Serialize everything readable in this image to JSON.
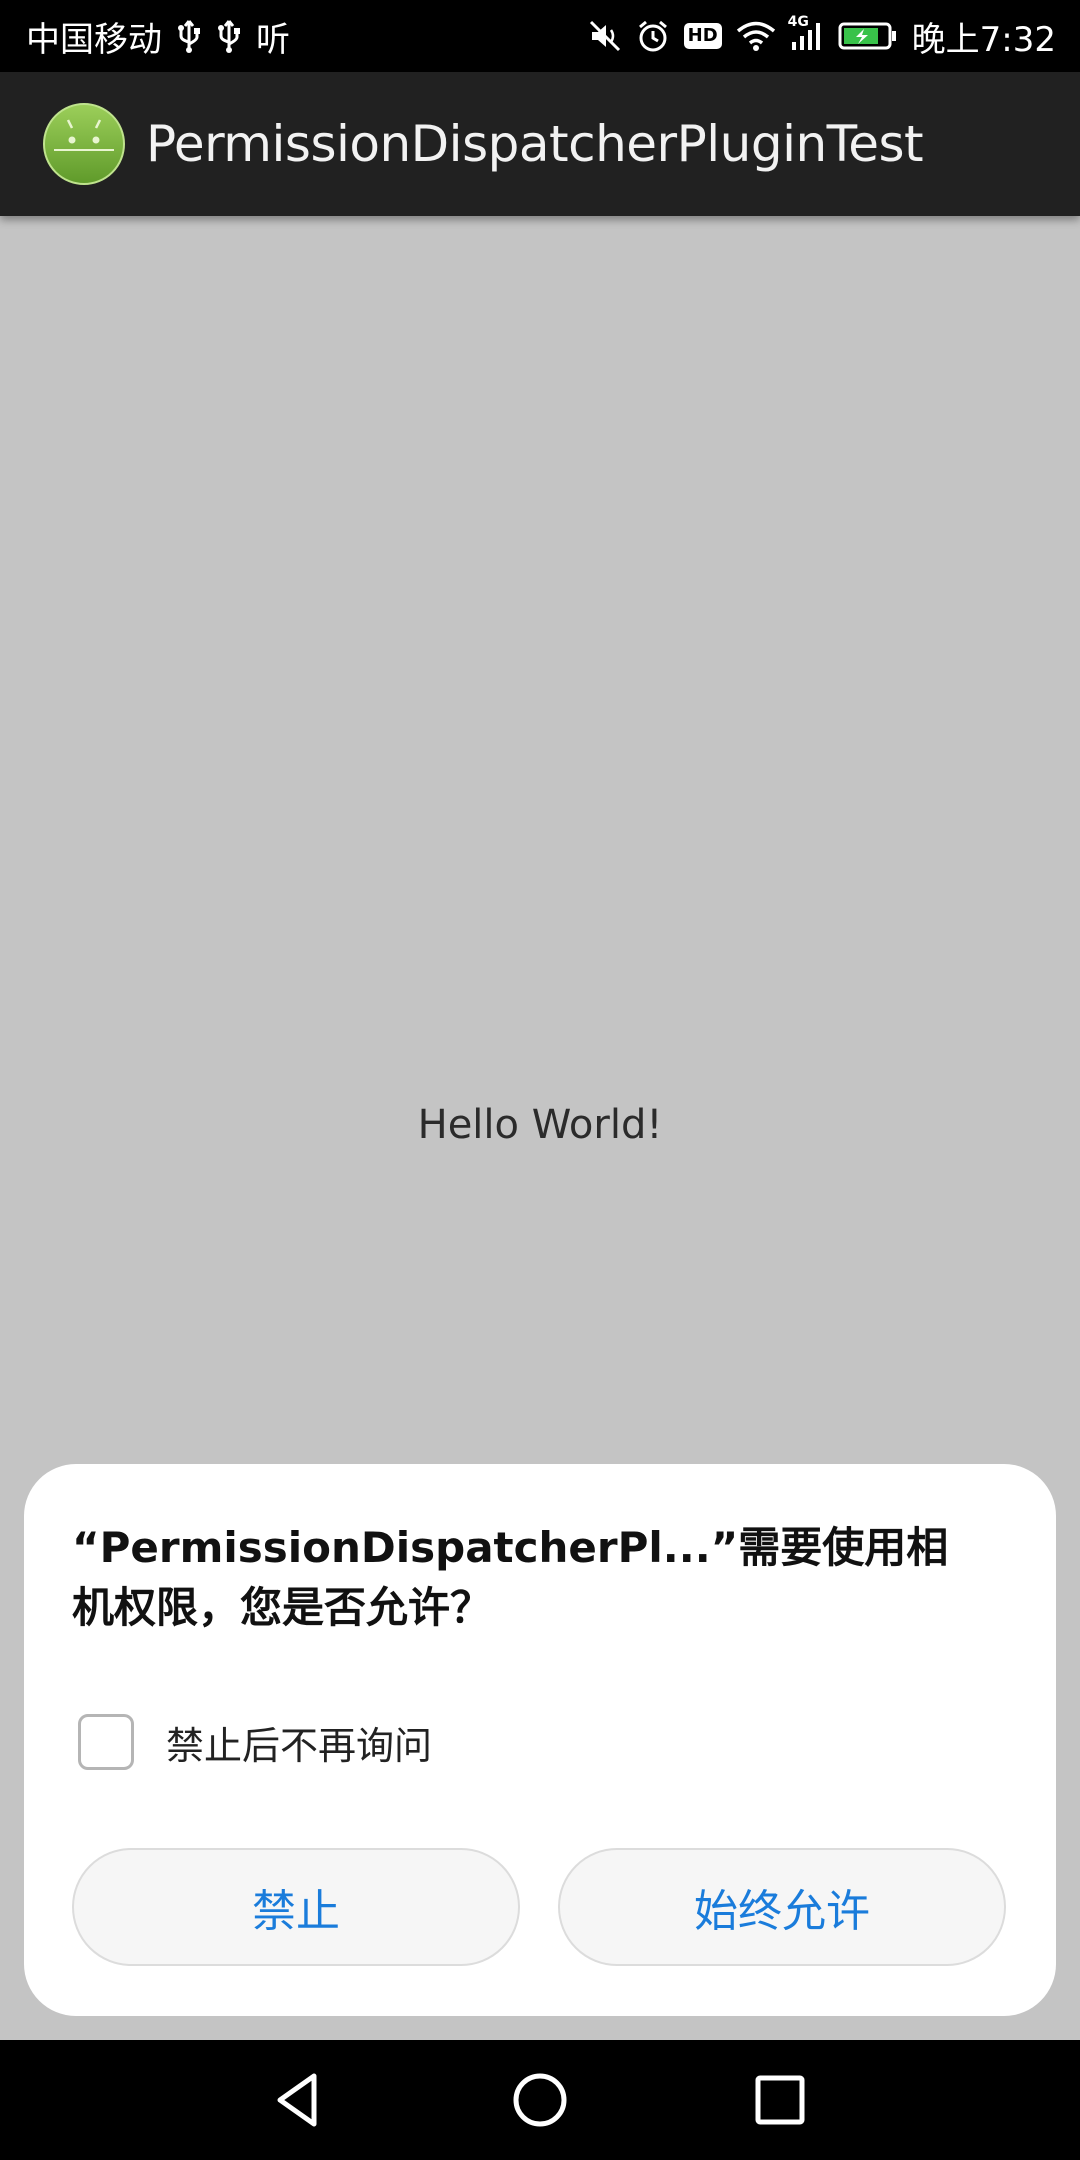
{
  "status_bar": {
    "carrier": "中国移动",
    "extra_text": "听",
    "network": "4G",
    "hd_badge": "HD",
    "time": "晚上7:32"
  },
  "action_bar": {
    "title": "PermissionDispatcherPluginTest",
    "icon": "android-robot-icon"
  },
  "main": {
    "text": "Hello World!"
  },
  "dialog": {
    "title": "“PermissionDispatcherPl...”需要使用相机权限，您是否允许？",
    "dont_ask_label": "禁止后不再询问",
    "deny_label": "禁止",
    "allow_label": "始终允许"
  },
  "colors": {
    "status_bar": "#000000",
    "action_bar": "#212121",
    "background_dim": "#c4c4c4",
    "dialog": "#ffffff",
    "button_text": "#1a7cdb"
  },
  "icons": [
    "usb-icon",
    "usb-icon",
    "mute-icon",
    "alarm-icon",
    "hd-icon",
    "wifi-icon",
    "signal-icon",
    "battery-charging-icon",
    "back-icon",
    "home-icon",
    "recents-icon"
  ]
}
